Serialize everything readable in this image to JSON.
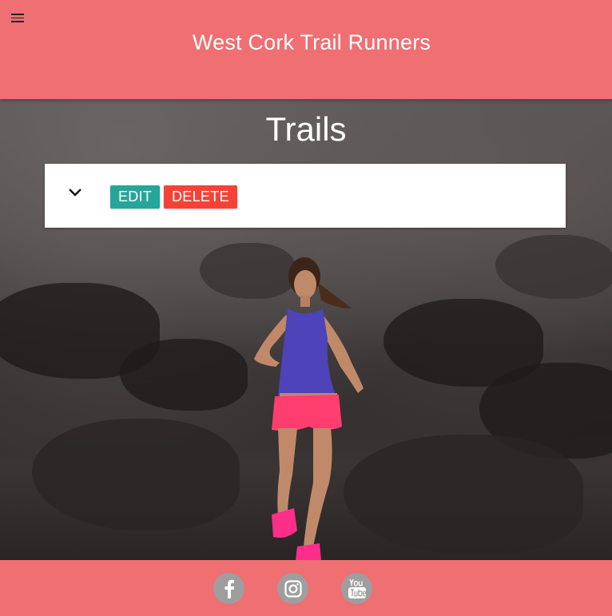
{
  "header": {
    "title": "West Cork Trail Runners",
    "menu_icon": "hamburger-menu-icon"
  },
  "main": {
    "heading": "Trails",
    "trail_card": {
      "expand_icon": "chevron-down-icon",
      "edit_label": "EDIT",
      "delete_label": "DELETE"
    }
  },
  "footer": {
    "social": [
      {
        "name": "facebook",
        "icon": "facebook-icon"
      },
      {
        "name": "instagram",
        "icon": "instagram-icon"
      },
      {
        "name": "youtube",
        "icon": "youtube-icon"
      }
    ]
  },
  "colors": {
    "header_bg": "#ef6f72",
    "footer_bg": "#ef6f72",
    "edit_button": "#26a69a",
    "delete_button": "#f44336",
    "social_icon_bg": "#9e9e9e"
  }
}
